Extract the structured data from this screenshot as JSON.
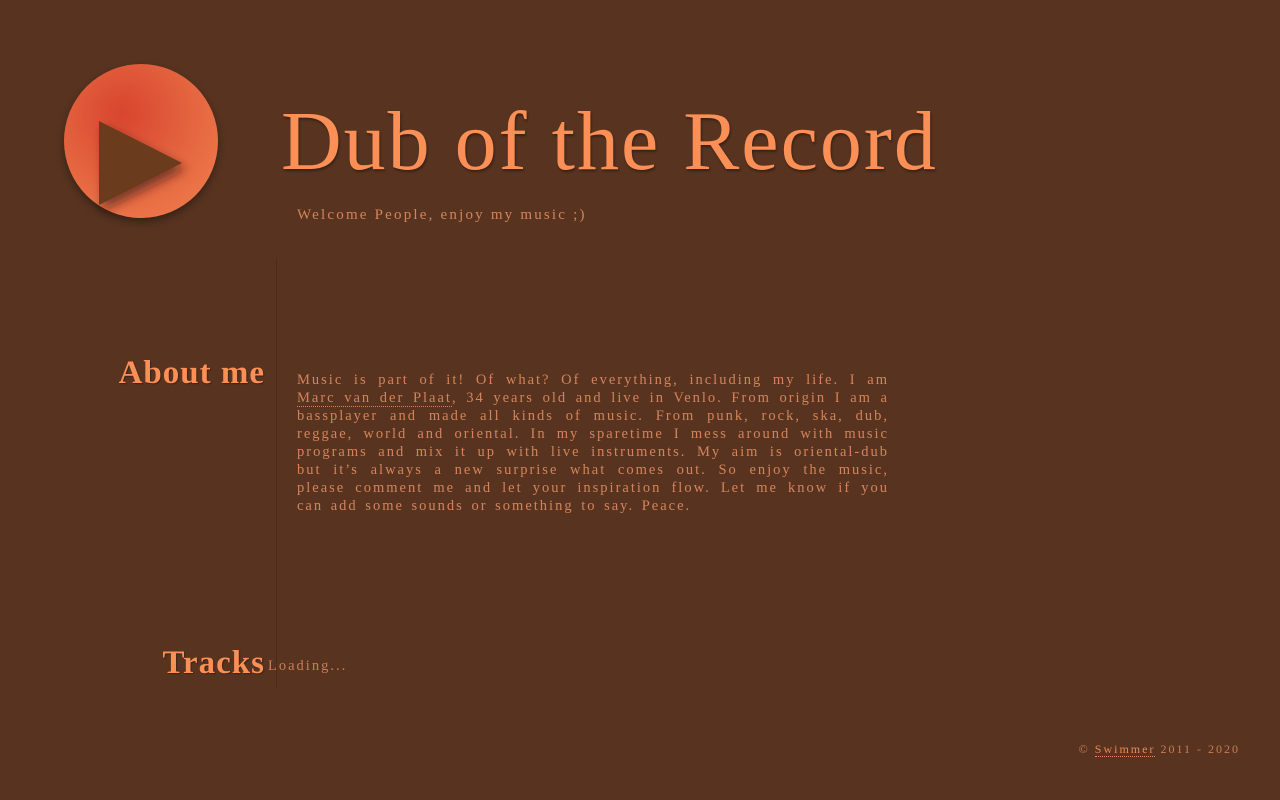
{
  "header": {
    "title": "Dub of the Record",
    "tagline": "Welcome People, enjoy my music ;)",
    "logo_icon": "play-icon"
  },
  "about": {
    "heading": "About me",
    "text_before_link": "Music is part of it! Of what? Of everything, including my life. I am ",
    "link_text": "Marc van der Plaat",
    "text_after_link": ", 34 years old and live in Venlo. From origin I am a bassplayer and made all kinds of music. From punk, rock, ska, dub, reggae, world and oriental. In my sparetime I mess around with music programs and mix it up with live instruments. My aim is oriental-dub but it’s always a new surprise what comes out. So enjoy the music, please comment me and let your inspiration flow. Let me know if you can add some sounds or something to say. Peace."
  },
  "tracks": {
    "heading": "Tracks",
    "status": "Loading..."
  },
  "footer": {
    "copyright_symbol": "©",
    "author_link": "Swimmer",
    "years": "2011 - 2020"
  },
  "colors": {
    "background": "#573320",
    "accent": "#fb8f55",
    "text": "#d4845a",
    "play_button": "#e2603d"
  }
}
